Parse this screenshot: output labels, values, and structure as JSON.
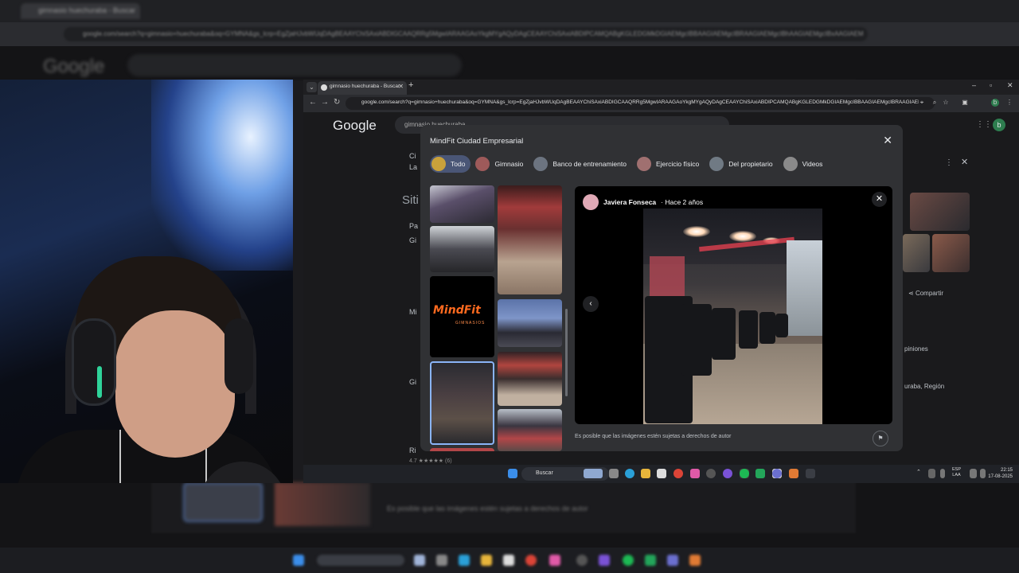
{
  "inner_browser": {
    "tab_title": "gimnasio huechuraba - Buscar",
    "url": "google.com/search?q=gimnasio+huechuraba&oq=GYMNA&gs_lcrp=EgZjaHJvbWUqDAgBEAAYChiSAxiABDIGCAAQRRg5MgwIARAAGAoYkgMYgAQyDAgCEAAYChiSAxiABDIPCAMQABgKGLEDGMkDGIAEMgcIBBAAGIAEMgcIBRAAGIAEMgcIBhAAGIAEMgcIBxAAGIAEMgcICBAAGIAE",
    "google_logo": "Google",
    "search_query": "gimnasio huechuraba",
    "window_controls": {
      "minimize": "–",
      "maximize": "▫",
      "close": "✕"
    }
  },
  "background_page": {
    "results_heading": "Siti",
    "share_label": "Compartir",
    "opinions_label": "piniones",
    "location_label": "uraba, Región",
    "rating_snippet": "4.7 ★★★★★ (6)",
    "result_snippets": [
      "Ci",
      "La",
      "Pa",
      "Gi",
      "Mi",
      "Gi",
      "Ri"
    ]
  },
  "modal": {
    "title": "MindFit Ciudad Empresarial",
    "close_icon": "close-icon",
    "chips": [
      {
        "label": "Todo",
        "active": true,
        "color": "#c9a13b"
      },
      {
        "label": "Gimnasio",
        "active": false,
        "color": "#9e5a5a"
      },
      {
        "label": "Banco de entrenamiento",
        "active": false,
        "color": "#6c7480"
      },
      {
        "label": "Ejercicio físico",
        "active": false,
        "color": "#a07070"
      },
      {
        "label": "Del propietario",
        "active": false,
        "color": "#707a84"
      },
      {
        "label": "Videos",
        "active": false,
        "color": "#8a8a8a"
      }
    ],
    "logo_text": "MindFit",
    "logo_subtext": "GIMNASIOS",
    "viewer": {
      "author": "Javiera Fonseca",
      "time_ago": "· Hace 2 años"
    },
    "copyright_note": "Es posible que las imágenes estén sujetas a derechos de autor"
  },
  "taskbar": {
    "search_label": "Buscar",
    "lang_top": "ESP",
    "lang_bottom": "LAA",
    "time": "22:15",
    "date": "17-08-2025"
  },
  "outer_screen": {
    "google_logo": "Google",
    "caption": "Es posible que las imágenes estén sujetas a derechos de autor"
  }
}
